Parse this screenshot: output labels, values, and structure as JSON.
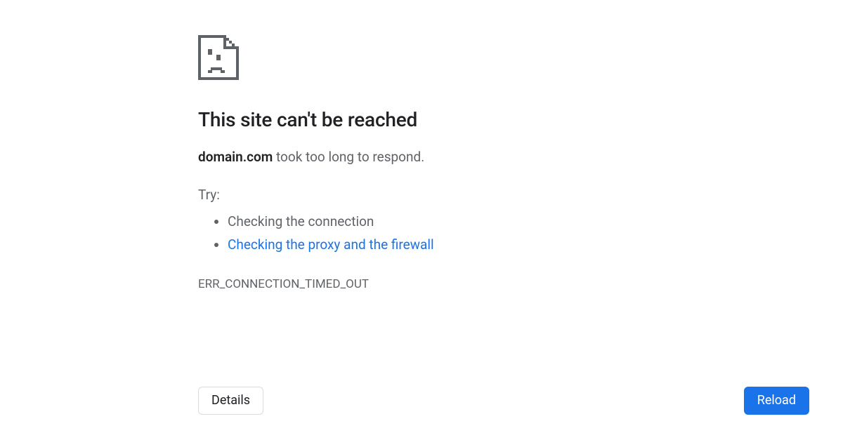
{
  "error": {
    "heading": "This site can't be reached",
    "domain": "domain.com",
    "message_suffix": " took too long to respond.",
    "try_label": "Try:",
    "suggestions": {
      "connection": "Checking the connection",
      "proxy": "Checking the proxy and the firewall"
    },
    "code": "ERR_CONNECTION_TIMED_OUT"
  },
  "buttons": {
    "details": "Details",
    "reload": "Reload"
  }
}
